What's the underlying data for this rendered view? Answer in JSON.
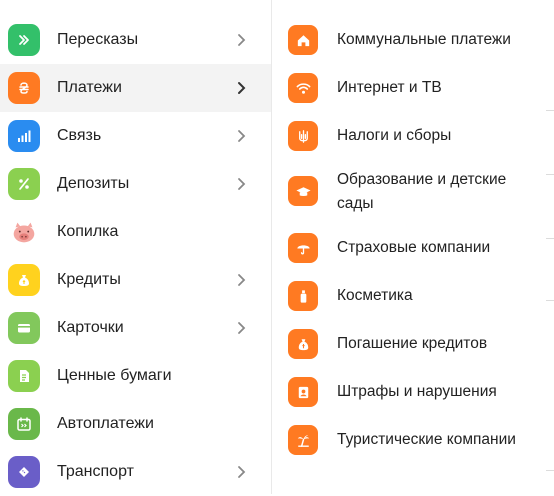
{
  "menu": {
    "items": [
      {
        "label": "Пересказы",
        "icon": "double-chevron-icon",
        "color": "#33c06a",
        "has_arrow": true
      },
      {
        "label": "Платежи",
        "icon": "hryvnia-icon",
        "color": "#ff7a22",
        "has_arrow": true,
        "active": true
      },
      {
        "label": "Связь",
        "icon": "signal-bars-icon",
        "color": "#2a8cf0",
        "has_arrow": true
      },
      {
        "label": "Депозиты",
        "icon": "percent-icon",
        "color": "#8bd050",
        "has_arrow": true
      },
      {
        "label": "Копилка",
        "icon": "piggy-bank-icon",
        "color": "#f7b7b2",
        "has_arrow": false
      },
      {
        "label": "Кредиты",
        "icon": "money-bag-icon",
        "color": "#ffd21e",
        "has_arrow": true
      },
      {
        "label": "Карточки",
        "icon": "card-icon",
        "color": "#82c85c",
        "has_arrow": true
      },
      {
        "label": "Ценные бумаги",
        "icon": "document-icon",
        "color": "#8bd050",
        "has_arrow": false
      },
      {
        "label": "Автоплатежи",
        "icon": "calendar-icon",
        "color": "#6ab84a",
        "has_arrow": false
      },
      {
        "label": "Транспорт",
        "icon": "ticket-icon",
        "color": "#6a5ec8",
        "has_arrow": true
      }
    ]
  },
  "submenu": {
    "accent": "#ff7a22",
    "items": [
      {
        "label": "Коммунальные платежи",
        "icon": "house-icon"
      },
      {
        "label": "Интернет и ТВ",
        "icon": "wifi-icon"
      },
      {
        "label": "Налоги и сборы",
        "icon": "trident-icon"
      },
      {
        "label_line1": "Образование и детские",
        "label_line2": "сады",
        "icon": "graduation-cap-icon"
      },
      {
        "label": "Страховые компании",
        "icon": "umbrella-icon"
      },
      {
        "label": "Косметика",
        "icon": "bottle-icon"
      },
      {
        "label": "Погашение кредитов",
        "icon": "money-bag-icon"
      },
      {
        "label": "Штрафы и нарушения",
        "icon": "id-badge-icon"
      },
      {
        "label": "Туристические компании",
        "icon": "palm-tree-icon"
      }
    ]
  }
}
